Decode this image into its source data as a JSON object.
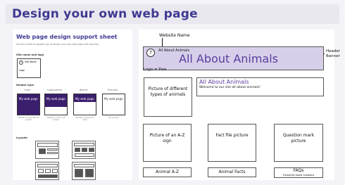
{
  "title": "Design your own web page",
  "sheet": {
    "title": "Web page design support sheet",
    "subtitle": "Use this sheet to support you to design your own web page with look like.",
    "site_heading": "Site name and logo",
    "site_name": "Site Name",
    "logo": "Logo",
    "logo_mark": "?",
    "header_heading": "Header type",
    "header_types": [
      {
        "label": "Cover",
        "thumb_text": "My web page",
        "caption": "Header covers whole screen",
        "color": "#3b1f6e"
      },
      {
        "label": "Large banner",
        "thumb_text": "My web page",
        "caption": "Header covers 1/3 screen",
        "color": "#3b1f6e"
      },
      {
        "label": "Banner",
        "thumb_text": "My web page",
        "caption": "Header covers thin strip",
        "color": "#3b1f6e"
      },
      {
        "label": "Title only",
        "thumb_text": "My web page",
        "caption": "No picture",
        "color": "#ffffff"
      }
    ],
    "layouts_heading": "Layouts"
  },
  "worksheet": {
    "website_name_label": "Website Name",
    "header_banner_label": "Header Banner",
    "logo_label": "Logo = Paw",
    "banner_small": "All About Animals",
    "banner_big": "All About Animals",
    "logo_mark": "?",
    "picture_box": "Picture of different types of animals",
    "intro_title": "All About Animals",
    "intro_text": "Welcome to our site all about animals!",
    "cards": [
      {
        "picture": "Picture of an A-Z sign",
        "nav": "Animal A-Z"
      },
      {
        "picture": "Fact file picture",
        "nav": "Animal Facts"
      },
      {
        "picture": "Question mark picture",
        "nav": "FAQs",
        "nav_sub": "Frequently Asked Questions"
      }
    ]
  },
  "colors": {
    "accent": "#3f3a91",
    "banner_fill": "#d7cfe9",
    "banner_text": "#5a3ea0"
  }
}
